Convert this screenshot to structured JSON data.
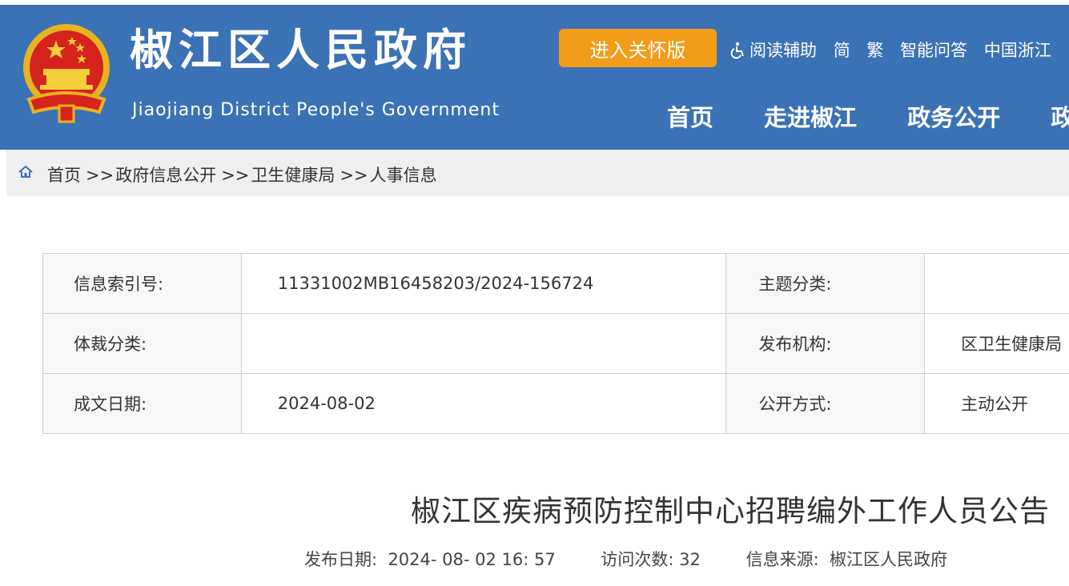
{
  "header": {
    "title": "椒江区人民政府",
    "subtitle": "Jiaojiang District People's Government",
    "care_button": "进入关怀版",
    "tools": [
      "阅读辅助",
      "简",
      "繁",
      "智能问答",
      "中国浙江"
    ],
    "nav": [
      "首页",
      "走进椒江",
      "政务公开",
      "政"
    ]
  },
  "breadcrumb": {
    "items": [
      "首页",
      "政府信息公开",
      "卫生健康局",
      "人事信息"
    ],
    "separator": ">>"
  },
  "info": {
    "rows": [
      {
        "label1": "信息索引号:",
        "value1": "11331002MB16458203/2024-156724",
        "label2": "主题分类:",
        "value2": ""
      },
      {
        "label1": "体裁分类:",
        "value1": "",
        "label2": "发布机构:",
        "value2": "区卫生健康局"
      },
      {
        "label1": "成文日期:",
        "value1": "2024-08-02",
        "label2": "公开方式:",
        "value2": "主动公开"
      }
    ]
  },
  "article": {
    "title": "椒江区疾病预防控制中心招聘编外工作人员公告",
    "publish_label": "发布日期:",
    "publish_value": "2024- 08- 02 16: 57",
    "visits_label": "访问次数:",
    "visits_value": "32",
    "source_label": "信息来源:",
    "source_value": "椒江区人民政府"
  },
  "colors": {
    "header_bg": "#3b72b5",
    "care_button_bg": "#f29c1a",
    "breadcrumb_bg": "#efefef"
  }
}
